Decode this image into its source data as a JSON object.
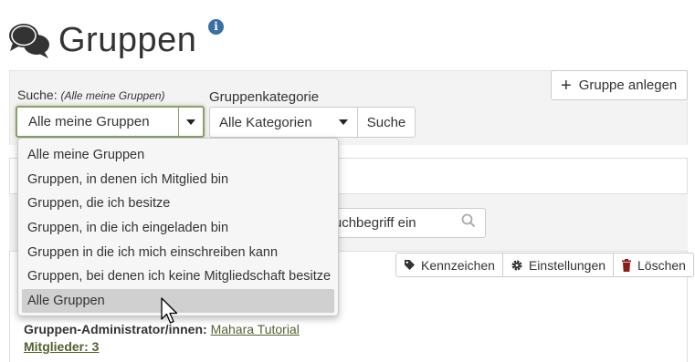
{
  "header": {
    "title": "Gruppen",
    "info_icon": "info-circle-icon",
    "groups_icon": "chat-bubbles-icon",
    "info_glyph": "i"
  },
  "search": {
    "label": "Suche:",
    "label_hint": "(Alle meine Gruppen)",
    "selected_value": "Alle meine Gruppen",
    "accent_color": "#8aa06b"
  },
  "category": {
    "label": "Gruppenkategorie",
    "selected_value": "Alle Kategorien"
  },
  "buttons": {
    "search": "Suche",
    "add_group": "Gruppe anlegen",
    "add_glyph": "+"
  },
  "filter": {
    "visible_text": "en Suchbegriff ein"
  },
  "dropdown": {
    "options": [
      "Alle meine Gruppen",
      "Gruppen, in denen ich Mitglied bin",
      "Gruppen, die ich besitze",
      "Gruppen, in die ich eingeladen bin",
      "Gruppen in die ich mich einschreiben kann",
      "Gruppen, bei denen ich keine Mitgliedschaft besitze",
      "Alle Gruppen"
    ],
    "highlighted": "Alle Gruppen"
  },
  "actions": {
    "tags": "Kennzeichen",
    "settings": "Einstellungen",
    "delete": "Löschen"
  },
  "group": {
    "admin_label": "Gruppen-Administrator/innen:",
    "admin_name": "Mahara Tutorial",
    "members_label": "Mitglieder: 3"
  },
  "colors": {
    "link": "#50622d",
    "info": "#3a6ea5"
  }
}
